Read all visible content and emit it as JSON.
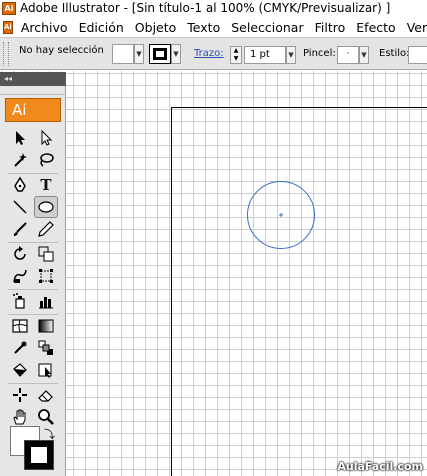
{
  "window": {
    "title": "Adobe Illustrator - [Sin título-1 al 100% (CMYK/Previsualizar) ]",
    "icon": "Ai"
  },
  "menubar": {
    "icon": "Ai",
    "items": [
      "Archivo",
      "Edición",
      "Objeto",
      "Texto",
      "Seleccionar",
      "Filtro",
      "Efecto",
      "Ver",
      "V"
    ]
  },
  "controlbar": {
    "selection_status": "No hay selección",
    "stroke_label": "Trazo:",
    "stroke_weight": "1 pt",
    "brush_label": "Pincel:",
    "brush_value": "·",
    "style_label": "Estilo:"
  },
  "tools_panel": {
    "collapse_glyph": "◂◂",
    "logo": "Ai",
    "text_tool_glyph": "T",
    "active_tool": "ellipse-tool"
  },
  "canvas": {
    "shape": "circle",
    "shape_stroke_color": "#3a6fc8"
  },
  "colors": {
    "logo": "#f08a1c",
    "accent_link": "#2a4fb5"
  },
  "watermark": "AulaFacil.com"
}
